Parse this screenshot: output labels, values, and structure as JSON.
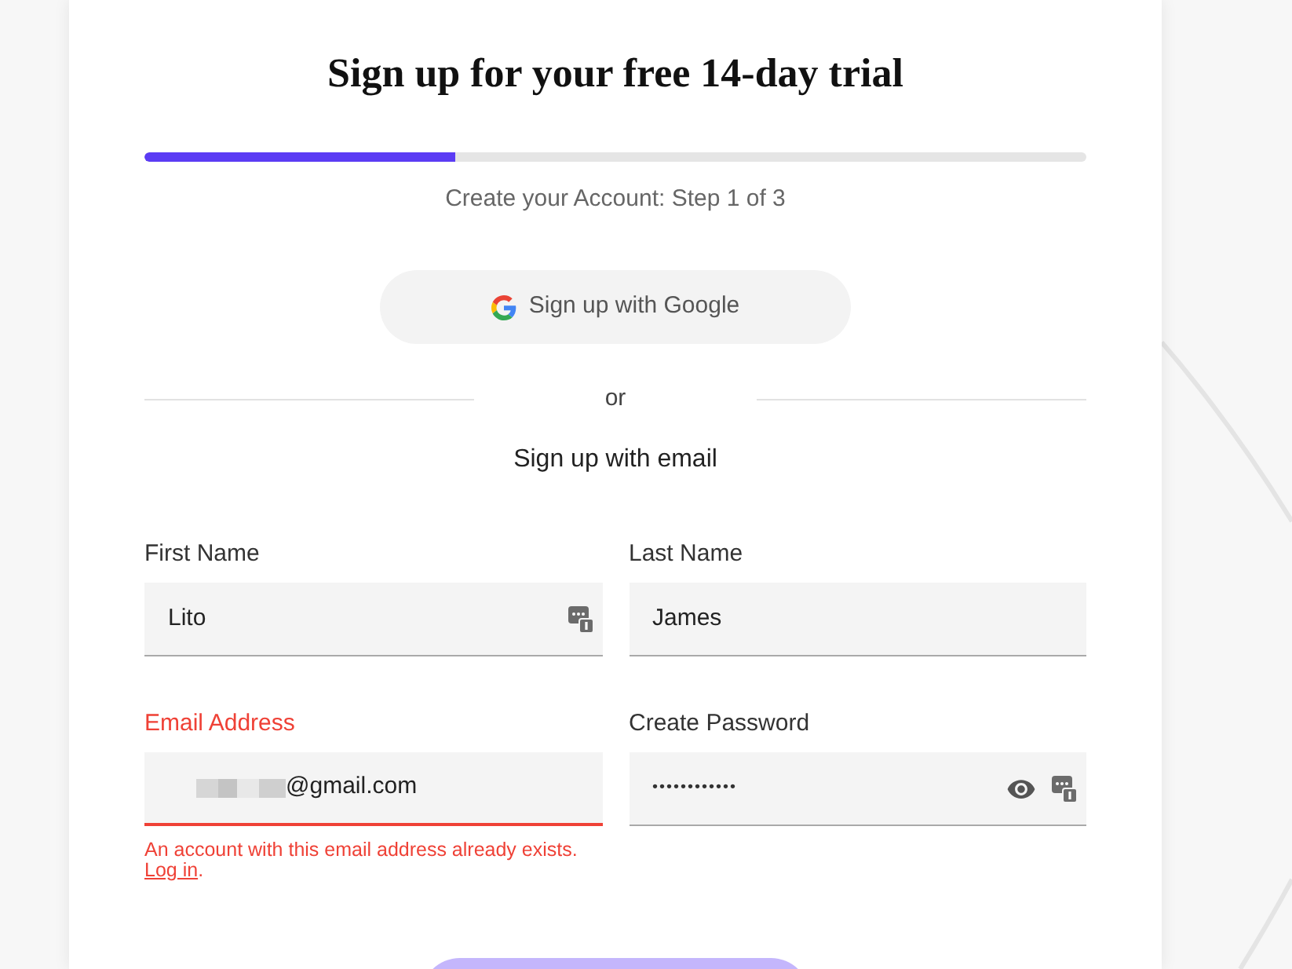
{
  "title": "Sign up for your free 14-day trial",
  "progress": {
    "level": 0.33,
    "label": "Create your Account: Step 1 of 3"
  },
  "google_button": {
    "label": "Sign up with Google"
  },
  "divider": {
    "label": "or"
  },
  "email_heading": "Sign up with email",
  "fields": [
    {
      "kind": "text",
      "label": "First Name",
      "value": "Lito",
      "error": false,
      "autofill_badge": true
    },
    {
      "kind": "text",
      "label": "Last Name",
      "value": "James",
      "error": false,
      "autofill_badge": false
    },
    {
      "kind": "email",
      "label": "Email Address",
      "value": "@gmail.com",
      "redacted": true,
      "error": true,
      "autofill_badge": false,
      "error_message": {
        "text": "An account with this email address already exists.",
        "link": "Log in",
        "after": "."
      }
    },
    {
      "kind": "password",
      "label": "Create Password",
      "value": "••••••••••••",
      "error": false,
      "autofill_badge": true
    }
  ],
  "submit_button": {
    "disabled": true
  }
}
